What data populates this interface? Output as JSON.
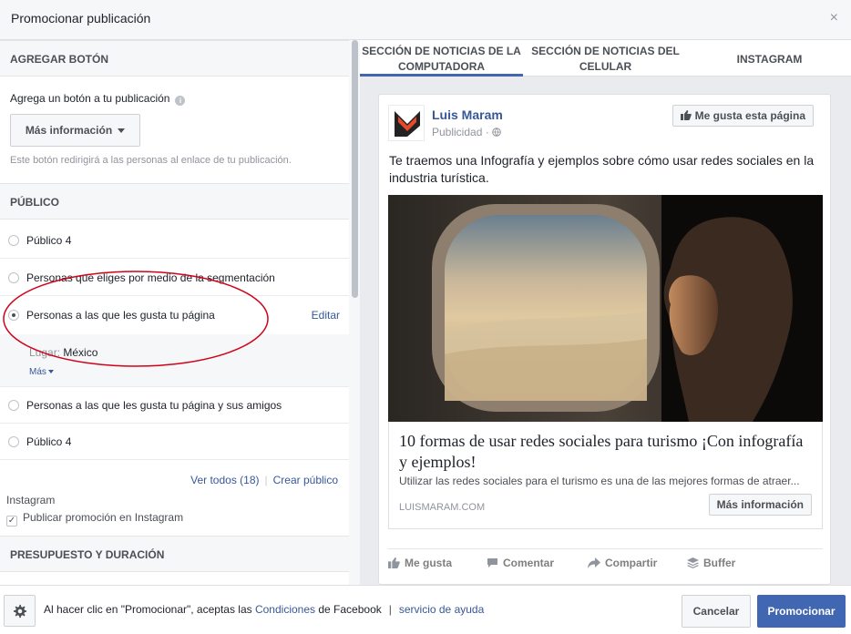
{
  "dialog": {
    "title": "Promocionar publicación",
    "close_label": "×"
  },
  "left": {
    "add_button": {
      "header": "AGREGAR BOTÓN",
      "label": "Agrega un botón a tu publicación",
      "info_icon": "i",
      "dropdown_value": "Más información",
      "hint": "Este botón redirigirá a las personas al enlace de tu publicación."
    },
    "audience": {
      "header": "PÚBLICO",
      "options": [
        {
          "label": "Público 4",
          "selected": false
        },
        {
          "label": "Personas que eliges por medio de la segmentación",
          "selected": false
        },
        {
          "label": "Personas a las que les gusta tu página",
          "selected": true
        },
        {
          "label": "Personas a las que les gusta tu página y sus amigos",
          "selected": false
        },
        {
          "label": "Público 4",
          "selected": false
        }
      ],
      "edit_label": "Editar",
      "location_key": "Lugar:",
      "location_value": "México",
      "more_label": "Más",
      "view_all": "Ver todos (18)",
      "create": "Crear público"
    },
    "instagram": {
      "title": "Instagram",
      "checkbox_label": "Publicar promoción en Instagram",
      "checked": true,
      "check_mark": "✓"
    },
    "budget": {
      "header": "PRESUPUESTO Y DURACIÓN"
    }
  },
  "preview": {
    "tabs": [
      {
        "label": "SECCIÓN DE NOTICIAS DE LA COMPUTADORA",
        "active": true
      },
      {
        "label": "SECCIÓN DE NOTICIAS DEL CELULAR",
        "active": false
      },
      {
        "label": "INSTAGRAM",
        "active": false
      }
    ],
    "post": {
      "page_name": "Luis Maram",
      "meta": "Publicidad",
      "meta_sep": "·",
      "like_page_label": "Me gusta esta página",
      "text": "Te traemos una Infografía y ejemplos sobre cómo usar redes sociales en la industria turística.",
      "link_title": "10 formas de usar redes sociales para turismo ¡Con infografía y ejemplos!",
      "link_description": "Utilizar las redes sociales para el turismo es una de las mejores formas de atraer...",
      "link_domain": "LUISMARAM.COM",
      "cta_label": "Más información",
      "actions": [
        "Me gusta",
        "Comentar",
        "Compartir",
        "Buffer"
      ]
    }
  },
  "footer": {
    "terms_prefix": "Al hacer clic en \"Promocionar\", aceptas las",
    "terms_link": "Condiciones",
    "terms_middle": "de Facebook",
    "pipe": "|",
    "help_link": "servicio de ayuda",
    "cancel_label": "Cancelar",
    "promote_label": "Promocionar"
  },
  "colors": {
    "accent": "#4267b2",
    "link": "#365899",
    "annotation": "#d0021b"
  }
}
